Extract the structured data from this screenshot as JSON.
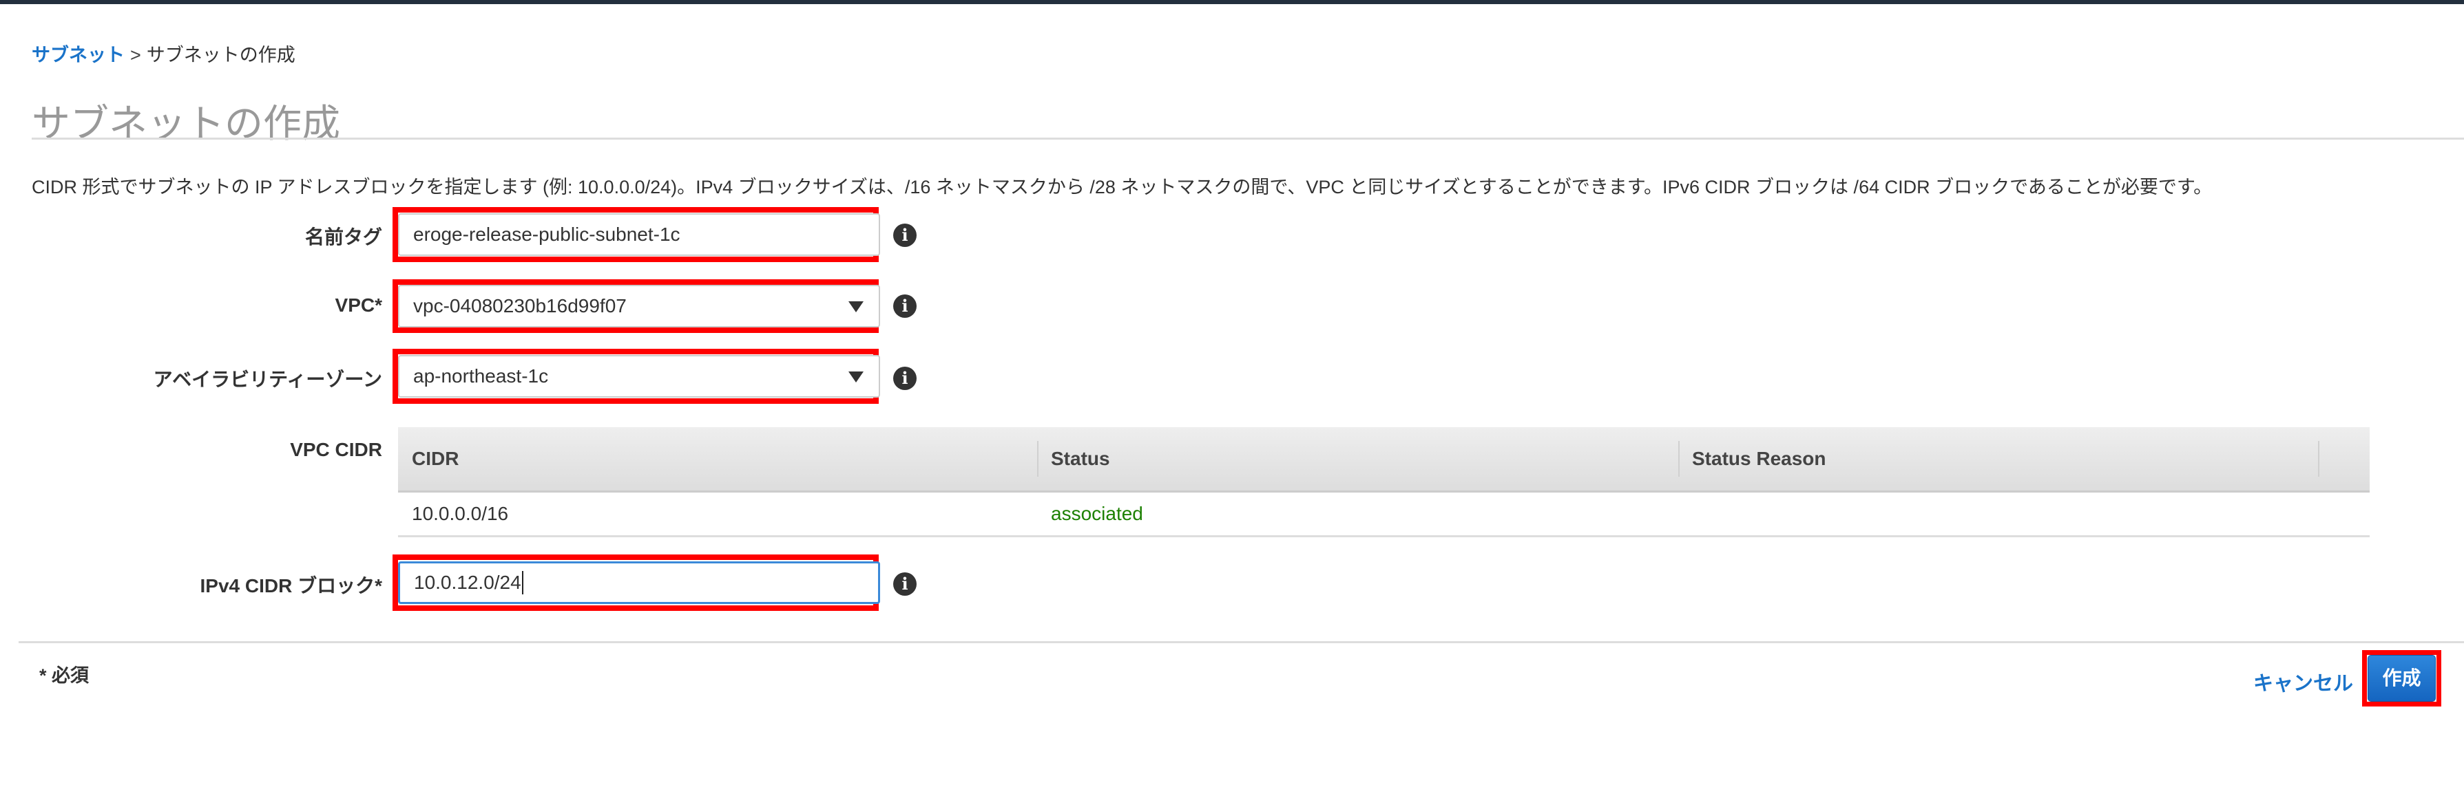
{
  "breadcrumb": {
    "parent": "サブネット",
    "separator": ">",
    "current": "サブネットの作成"
  },
  "page_title": "サブネットの作成",
  "description": "CIDR 形式でサブネットの IP アドレスブロックを指定します (例: 10.0.0.0/24)。IPv4 ブロックサイズは、/16 ネットマスクから /28 ネットマスクの間で、VPC と同じサイズとすることができます。IPv6 CIDR ブロックは /64 CIDR ブロックであることが必要です。",
  "form": {
    "name_tag": {
      "label": "名前タグ",
      "value": "eroge-release-public-subnet-1c"
    },
    "vpc": {
      "label": "VPC*",
      "value": "vpc-04080230b16d99f07"
    },
    "az": {
      "label": "アベイラビリティーゾーン",
      "value": "ap-northeast-1c"
    },
    "vpc_cidr": {
      "label": "VPC CIDR",
      "columns": [
        "CIDR",
        "Status",
        "Status Reason"
      ],
      "rows": [
        {
          "cidr": "10.0.0.0/16",
          "status": "associated",
          "reason": ""
        }
      ]
    },
    "ipv4_cidr": {
      "label": "IPv4 CIDR ブロック*",
      "value": "10.0.12.0/24"
    },
    "info_icon": "i"
  },
  "footer": {
    "required_note": "* 必須",
    "cancel_label": "キャンセル",
    "create_label": "作成"
  },
  "colors": {
    "accent": "#1a73c9",
    "highlight": "#ff0000",
    "status_ok": "#1d8102"
  }
}
